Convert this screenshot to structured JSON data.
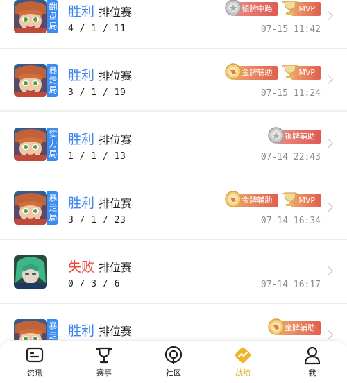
{
  "matches": [
    {
      "mode_tag": "翻盘局",
      "result": "胜利",
      "result_type": "win",
      "mode": "排位赛",
      "kda": "4 / 1 / 11",
      "time": "07-15 11:42",
      "badges": [
        {
          "label": "银牌中路",
          "kind": "silver"
        },
        {
          "label": "MVP",
          "kind": "mvp"
        }
      ],
      "avatar": "hero-a"
    },
    {
      "mode_tag": "暴走局",
      "result": "胜利",
      "result_type": "win",
      "mode": "排位赛",
      "kda": "3 / 1 / 19",
      "time": "07-15 11:24",
      "badges": [
        {
          "label": "金牌辅助",
          "kind": "gold"
        },
        {
          "label": "MVP",
          "kind": "mvp"
        }
      ],
      "avatar": "hero-a"
    },
    {
      "mode_tag": "实力局",
      "result": "胜利",
      "result_type": "win",
      "mode": "排位赛",
      "kda": "1 / 1 / 13",
      "time": "07-14 22:43",
      "badges": [
        {
          "label": "银牌辅助",
          "kind": "silver"
        }
      ],
      "avatar": "hero-a"
    },
    {
      "mode_tag": "暴走局",
      "result": "胜利",
      "result_type": "win",
      "mode": "排位赛",
      "kda": "3 / 1 / 23",
      "time": "07-14 16:34",
      "badges": [
        {
          "label": "金牌辅助",
          "kind": "gold"
        },
        {
          "label": "MVP",
          "kind": "mvp"
        }
      ],
      "avatar": "hero-a"
    },
    {
      "mode_tag": "",
      "result": "失败",
      "result_type": "lose",
      "mode": "排位赛",
      "kda": "0 / 3 / 6",
      "time": "07-14 16:17",
      "badges": [],
      "avatar": "hero-b"
    },
    {
      "mode_tag": "暴走局",
      "result": "胜利",
      "result_type": "win",
      "mode": "排位赛",
      "kda": "",
      "time": "",
      "badges": [
        {
          "label": "金牌辅助",
          "kind": "gold"
        }
      ],
      "avatar": "hero-a"
    }
  ],
  "nav": [
    {
      "label": "资讯",
      "icon": "news-icon",
      "active": false
    },
    {
      "label": "赛事",
      "icon": "trophy-icon",
      "active": false
    },
    {
      "label": "社区",
      "icon": "community-icon",
      "active": false
    },
    {
      "label": "战绩",
      "icon": "stats-icon",
      "active": true
    },
    {
      "label": "我",
      "icon": "profile-icon",
      "active": false
    }
  ],
  "colors": {
    "win": "#3c84f0",
    "lose": "#e8473a",
    "tag": "#3b8cf0",
    "active": "#e4a81e"
  }
}
